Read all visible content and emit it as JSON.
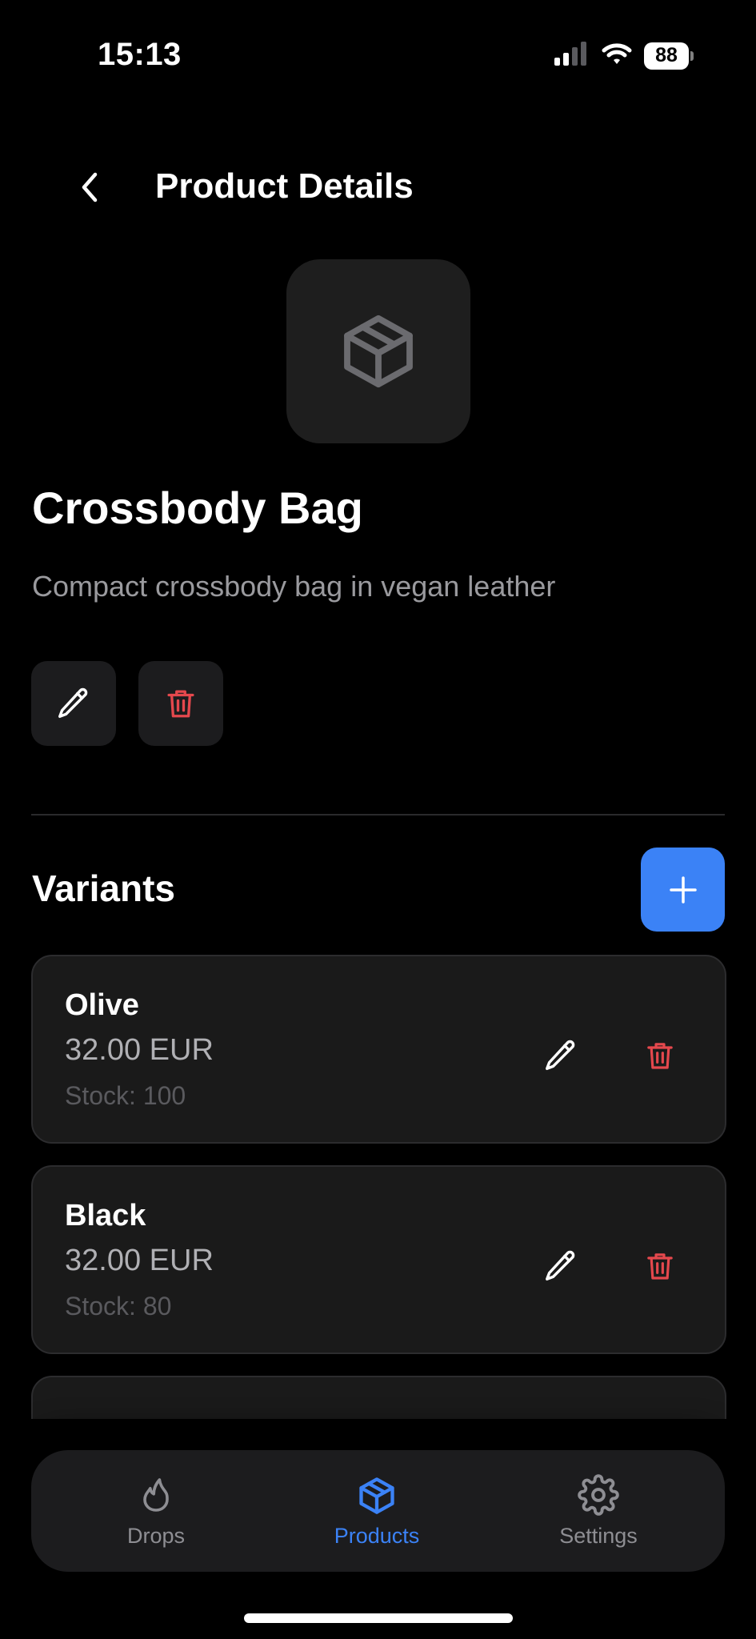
{
  "status_bar": {
    "time": "15:13",
    "battery": "88"
  },
  "header": {
    "title": "Product Details"
  },
  "product": {
    "name": "Crossbody Bag",
    "description": "Compact crossbody bag in vegan leather"
  },
  "variants_section": {
    "title": "Variants"
  },
  "variants": [
    {
      "name": "Olive",
      "price": "32.00 EUR",
      "stock": "Stock: 100"
    },
    {
      "name": "Black",
      "price": "32.00 EUR",
      "stock": "Stock: 80"
    }
  ],
  "tabs": [
    {
      "label": "Drops",
      "icon": "flame-icon",
      "active": false
    },
    {
      "label": "Products",
      "icon": "box-icon",
      "active": true
    },
    {
      "label": "Settings",
      "icon": "gear-icon",
      "active": false
    }
  ],
  "colors": {
    "accent": "#3b82f6",
    "destructive": "#e5484d",
    "background": "#000000",
    "card": "#1a1a1a",
    "inactive_tab": "#8e8e93"
  }
}
